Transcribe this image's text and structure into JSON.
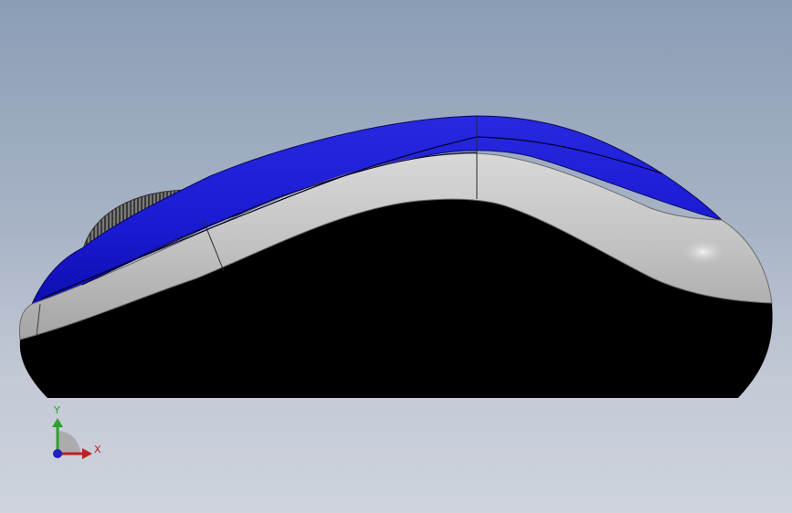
{
  "viewport": {
    "background_top": "#8b9db5",
    "background_bottom": "#ced3dc"
  },
  "model": {
    "name": "computer-mouse",
    "view": "side-view",
    "colors": {
      "top_shell": "#1a1ad2",
      "side_panel": "#c4c4c4",
      "base": "#000000",
      "scroll_wheel": "#555555"
    }
  },
  "triad": {
    "x_label": "X",
    "y_label": "Y",
    "colors": {
      "x": "#c02020",
      "y": "#2fa02f",
      "z": "#2020c0"
    }
  }
}
